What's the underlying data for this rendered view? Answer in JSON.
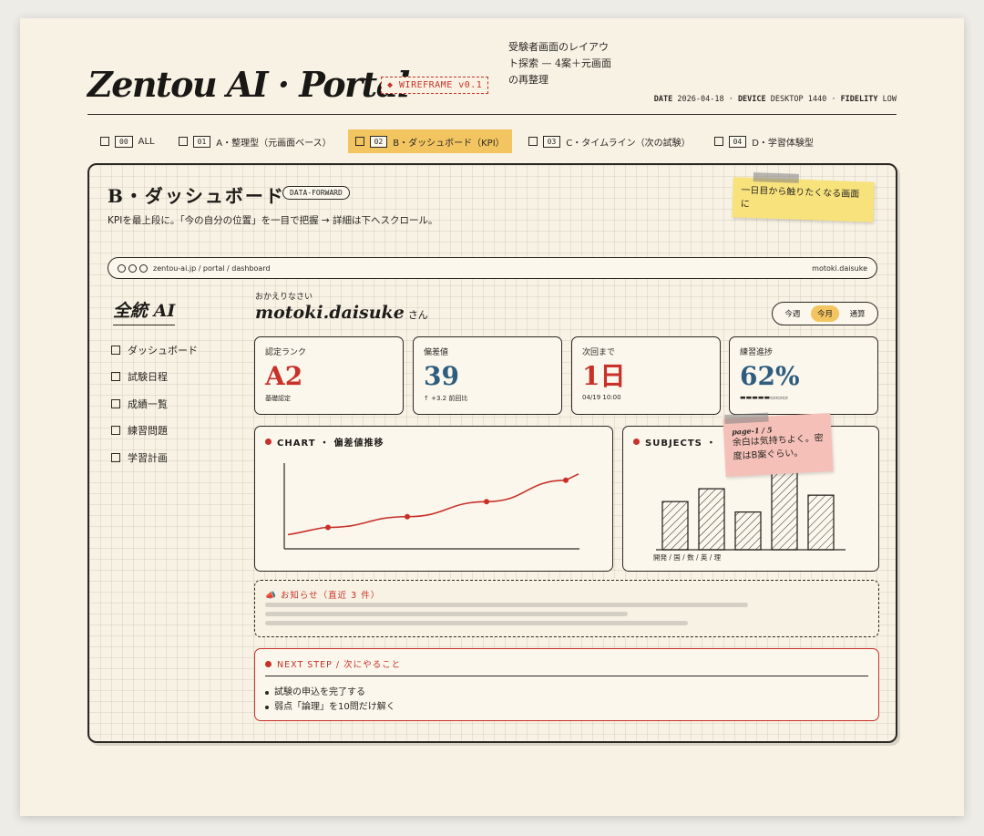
{
  "header": {
    "title": "Zentou AI · Portal",
    "wire_tag": "◆ WIREFRAME v0.1",
    "note": "受験者画面のレイアウト探索 — 4案＋元画面の再整理",
    "meta": {
      "date_label": "DATE",
      "date": "2026-04-18",
      "device_label": "DEVICE",
      "device": "DESKTOP 1440",
      "fidelity_label": "FIDELITY",
      "fidelity": "LOW"
    }
  },
  "tabs": [
    {
      "num": "00",
      "label": "ALL"
    },
    {
      "num": "01",
      "label": "A・整理型（元画面ベース）"
    },
    {
      "num": "02",
      "label": "B・ダッシュボード（KPI）"
    },
    {
      "num": "03",
      "label": "C・タイムライン（次の試験）"
    },
    {
      "num": "04",
      "label": "D・学習体験型"
    }
  ],
  "frame": {
    "title": "B・ダッシュボード",
    "tag": "DATA-FORWARD",
    "desc": "KPIを最上段に。「今の自分の位置」を一目で把握 → 詳細は下へスクロール。",
    "sticky": "一日目から触りたくなる画面に"
  },
  "urlbar": {
    "url": "zentou-ai.jp / portal / dashboard",
    "user": "motoki.daisuke"
  },
  "sidebar": {
    "brand": "全統 AI",
    "items": [
      {
        "label": "ダッシュボード"
      },
      {
        "label": "試験日程"
      },
      {
        "label": "成績一覧"
      },
      {
        "label": "練習問題"
      },
      {
        "label": "学習計画"
      }
    ]
  },
  "welcome": {
    "small": "おかえりなさい",
    "name": "motoki.daisuke",
    "suffix": "さん"
  },
  "period": {
    "options": [
      "今週",
      "今月",
      "通算"
    ],
    "selected": "今月"
  },
  "kpis": [
    {
      "label": "認定ランク",
      "value": "A2",
      "sub": "基礎認定",
      "color": "red"
    },
    {
      "label": "偏差値",
      "value": "39",
      "sub": "↑ +3.2 前回比",
      "color": "blue"
    },
    {
      "label": "次回まで",
      "value": "1日",
      "sub": "04/19 10:00",
      "color": "red"
    },
    {
      "label": "練習進捗",
      "value": "62%",
      "sub": "▬▬▬▬▬▭▭▭",
      "color": "blue",
      "progress": 0.62
    }
  ],
  "chart": {
    "title": "CHART ・ 偏差値推移"
  },
  "subjects": {
    "title": "SUBJECTS ・",
    "xlabel": "開発 / 国 / 数 / 英 / 理",
    "sticky_page": "page-1 / 5",
    "sticky": "余白は気持ちよく。密度はB案ぐらい。"
  },
  "chart_data": [
    {
      "type": "line",
      "title": "CHART ・ 偏差値推移",
      "x": [
        1,
        2,
        3,
        4
      ],
      "series": [
        {
          "values": [
            30,
            35,
            42,
            52
          ]
        }
      ],
      "ylim": [
        20,
        60
      ],
      "grid": false
    },
    {
      "type": "bar",
      "title": "SUBJECTS ・",
      "categories": [
        "開発",
        "国",
        "数",
        "英",
        "理"
      ],
      "values": [
        60,
        76,
        47,
        100,
        68
      ],
      "ylim": [
        0,
        100
      ],
      "grid": false
    }
  ],
  "news": {
    "title": "📣 お知らせ（直近 3 件）"
  },
  "next": {
    "title": "NEXT STEP / 次にやること",
    "items": [
      "試験の申込を完了する",
      "弱点「論理」を10問だけ解く"
    ]
  },
  "colors": {
    "accent": "#c8312a",
    "highlight": "#f3c561",
    "blue": "#2f5d7e",
    "paper": "#f7f2e4"
  }
}
